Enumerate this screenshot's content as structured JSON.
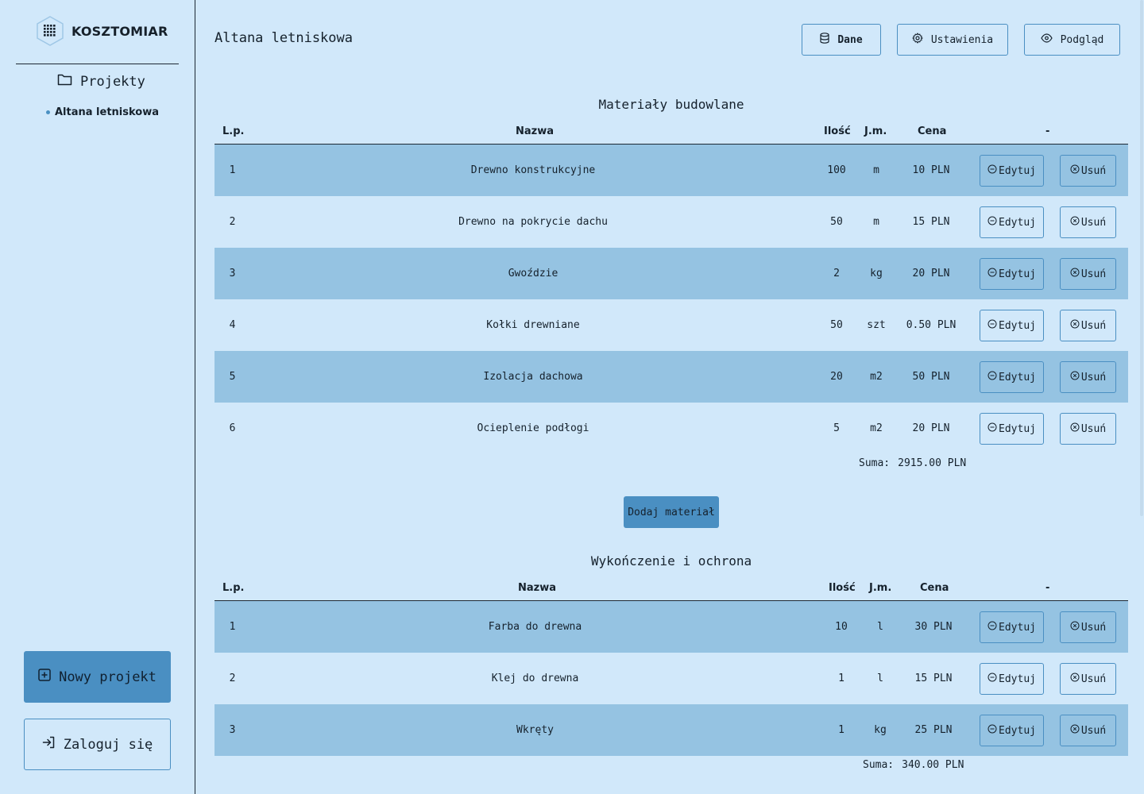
{
  "brand": {
    "name": "KOSZTOMIAR"
  },
  "sidebar": {
    "projects_label": "Projekty",
    "project_item": "Altana letniskowa",
    "new_project_label": "Nowy projekt",
    "login_label": "Zaloguj się"
  },
  "header": {
    "title": "Altana letniskowa",
    "buttons": {
      "data": "Dane",
      "settings": "Ustawienia",
      "preview": "Podgląd"
    }
  },
  "table_headers": {
    "lp": "L.p.",
    "name": "Nazwa",
    "qty": "Ilość",
    "unit": "J.m.",
    "price": "Cena",
    "actions": "-"
  },
  "row_actions": {
    "edit": "Edytuj",
    "delete": "Usuń"
  },
  "sections": [
    {
      "title": "Materiały budowlane",
      "rows": [
        {
          "lp": "1",
          "name": "Drewno konstrukcyjne",
          "qty": "100",
          "unit": "m",
          "price": "10 PLN"
        },
        {
          "lp": "2",
          "name": "Drewno na pokrycie dachu",
          "qty": "50",
          "unit": "m",
          "price": "15 PLN"
        },
        {
          "lp": "3",
          "name": "Gwoździe",
          "qty": "2",
          "unit": "kg",
          "price": "20 PLN"
        },
        {
          "lp": "4",
          "name": "Kołki drewniane",
          "qty": "50",
          "unit": "szt",
          "price": "0.50 PLN"
        },
        {
          "lp": "5",
          "name": "Izolacja dachowa",
          "qty": "20",
          "unit": "m2",
          "price": "50 PLN"
        },
        {
          "lp": "6",
          "name": "Ocieplenie podłogi",
          "qty": "5",
          "unit": "m2",
          "price": "20 PLN"
        }
      ],
      "sum_label": "Suma:",
      "sum_value": "2915.00 PLN",
      "add_label": "Dodaj materiał"
    },
    {
      "title": "Wykończenie i ochrona",
      "rows": [
        {
          "lp": "1",
          "name": "Farba do drewna",
          "qty": "10",
          "unit": "l",
          "price": "30 PLN"
        },
        {
          "lp": "2",
          "name": "Klej do drewna",
          "qty": "1",
          "unit": "l",
          "price": "15 PLN"
        },
        {
          "lp": "3",
          "name": "Wkręty",
          "qty": "1",
          "unit": "kg",
          "price": "25 PLN"
        }
      ],
      "sum_label": "Suma:",
      "sum_value": "340.00 PLN"
    }
  ],
  "colors": {
    "background": "#d1e8fa",
    "accent": "#4a8fc2",
    "row_shade": "#95c3e2",
    "text": "#15212c"
  }
}
